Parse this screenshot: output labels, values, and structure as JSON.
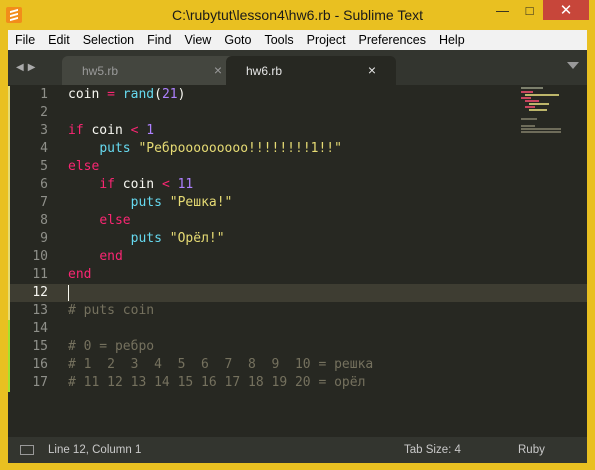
{
  "window": {
    "title": "C:\\rubytut\\lesson4\\hw6.rb - Sublime Text"
  },
  "menu": [
    "File",
    "Edit",
    "Selection",
    "Find",
    "View",
    "Goto",
    "Tools",
    "Project",
    "Preferences",
    "Help"
  ],
  "tabs": [
    {
      "label": "hw5.rb",
      "active": false
    },
    {
      "label": "hw6.rb",
      "active": true
    }
  ],
  "editor": {
    "lines": [
      {
        "n": "1",
        "mark": "yellow",
        "tokens": [
          [
            "",
            "coin "
          ],
          [
            "k",
            "="
          ],
          [
            "",
            " "
          ],
          [
            "f",
            "rand"
          ],
          [
            "",
            "("
          ],
          [
            "n",
            "21"
          ],
          [
            "",
            ")"
          ]
        ]
      },
      {
        "n": "2",
        "mark": "yellow",
        "tokens": []
      },
      {
        "n": "3",
        "mark": "yellow",
        "tokens": [
          [
            "k",
            "if"
          ],
          [
            "",
            " coin "
          ],
          [
            "k",
            "<"
          ],
          [
            "",
            " "
          ],
          [
            "n",
            "1"
          ]
        ]
      },
      {
        "n": "4",
        "mark": "yellow",
        "tokens": [
          [
            "",
            "    "
          ],
          [
            "f",
            "puts"
          ],
          [
            "",
            " "
          ],
          [
            "s",
            "\"Реброоооооооо!!!!!!!!1!!\""
          ]
        ]
      },
      {
        "n": "5",
        "mark": "yellow",
        "tokens": [
          [
            "k",
            "else"
          ]
        ]
      },
      {
        "n": "6",
        "mark": "yellow",
        "tokens": [
          [
            "",
            "    "
          ],
          [
            "k",
            "if"
          ],
          [
            "",
            " coin "
          ],
          [
            "k",
            "<"
          ],
          [
            "",
            " "
          ],
          [
            "n",
            "11"
          ]
        ]
      },
      {
        "n": "7",
        "mark": "yellow",
        "tokens": [
          [
            "",
            "        "
          ],
          [
            "f",
            "puts"
          ],
          [
            "",
            " "
          ],
          [
            "s",
            "\"Решка!\""
          ]
        ]
      },
      {
        "n": "8",
        "mark": "yellow",
        "tokens": [
          [
            "",
            "    "
          ],
          [
            "k",
            "else"
          ]
        ]
      },
      {
        "n": "9",
        "mark": "yellow",
        "tokens": [
          [
            "",
            "        "
          ],
          [
            "f",
            "puts"
          ],
          [
            "",
            " "
          ],
          [
            "s",
            "\"Орёл!\""
          ]
        ]
      },
      {
        "n": "10",
        "mark": "yellow",
        "tokens": [
          [
            "",
            "    "
          ],
          [
            "k",
            "end"
          ]
        ]
      },
      {
        "n": "11",
        "mark": "yellow",
        "tokens": [
          [
            "k",
            "end"
          ]
        ]
      },
      {
        "n": "12",
        "mark": "yellow",
        "tokens": [],
        "current": true
      },
      {
        "n": "13",
        "mark": "yellow",
        "tokens": [
          [
            "c",
            "# puts coin"
          ]
        ]
      },
      {
        "n": "14",
        "mark": "green",
        "tokens": []
      },
      {
        "n": "15",
        "mark": "green",
        "tokens": [
          [
            "c",
            "# 0 = ребро"
          ]
        ]
      },
      {
        "n": "16",
        "mark": "green",
        "tokens": [
          [
            "c",
            "# 1  2  3  4  5  6  7  8  9  10 = решка"
          ]
        ]
      },
      {
        "n": "17",
        "mark": "green",
        "tokens": [
          [
            "c",
            "# 11 12 13 14 15 16 17 18 19 20 = орёл"
          ]
        ]
      }
    ]
  },
  "status": {
    "position": "Line 12, Column 1",
    "tab_size": "Tab Size: 4",
    "syntax": "Ruby"
  },
  "colors": {
    "yellow": "#e6db74",
    "green": "#a6e22e",
    "accent": "#e9c021"
  }
}
